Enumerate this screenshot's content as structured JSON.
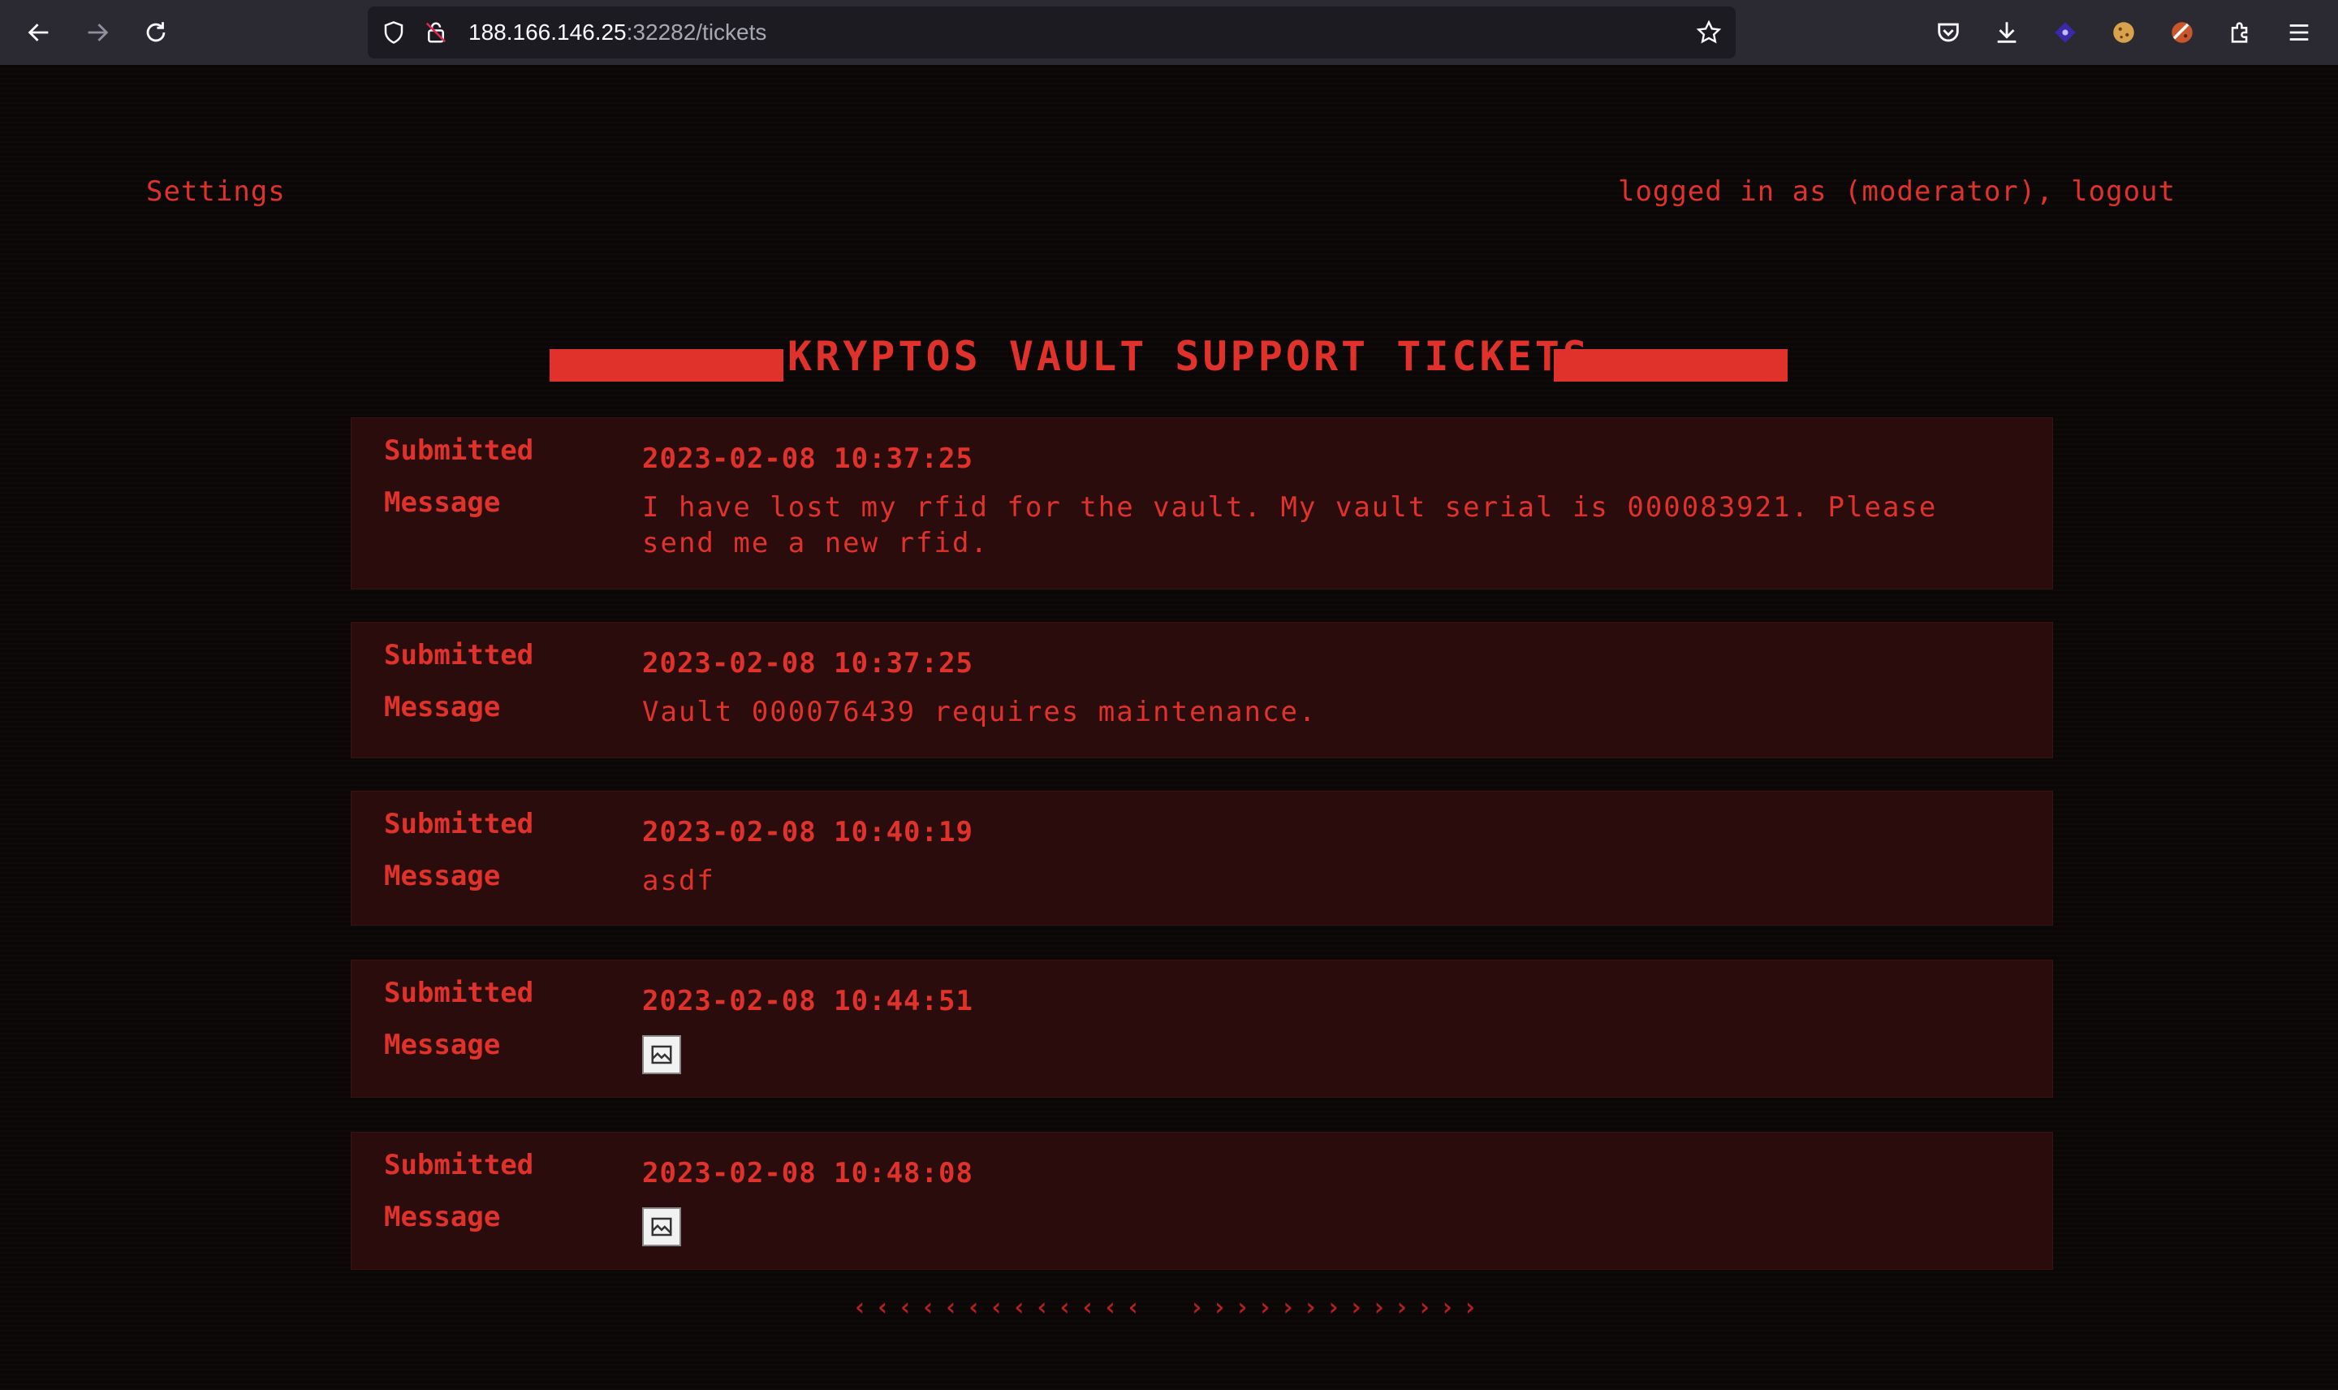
{
  "browser": {
    "url_host": "188.166.146.25",
    "url_path": ":32282/tickets"
  },
  "nav": {
    "settings_label": "Settings",
    "session_label": "logged in as (moderator), logout"
  },
  "header": {
    "title": "KRYPTOS VAULT SUPPORT TICKETS"
  },
  "labels": {
    "submitted": "Submitted",
    "message": "Message"
  },
  "tickets": [
    {
      "submitted": "2023-02-08 10:37:25",
      "message": "I have lost my rfid for the vault. My vault serial is 000083921. Please send me a new rfid."
    },
    {
      "submitted": "2023-02-08 10:37:25",
      "message": "Vault 000076439 requires maintenance."
    },
    {
      "submitted": "2023-02-08 10:40:19",
      "message": "asdf"
    },
    {
      "submitted": "2023-02-08 10:44:51",
      "message_icon": "broken-image-icon"
    },
    {
      "submitted": "2023-02-08 10:48:08",
      "message_icon": "broken-image-icon"
    }
  ],
  "pagination": {
    "prev": "‹‹‹‹‹‹‹‹‹‹‹‹‹",
    "next": "›››››››››››››"
  },
  "colors": {
    "accent": "#e0322a",
    "ticket_bg": "#2a0c0c",
    "page_bg": "#0c0707"
  }
}
